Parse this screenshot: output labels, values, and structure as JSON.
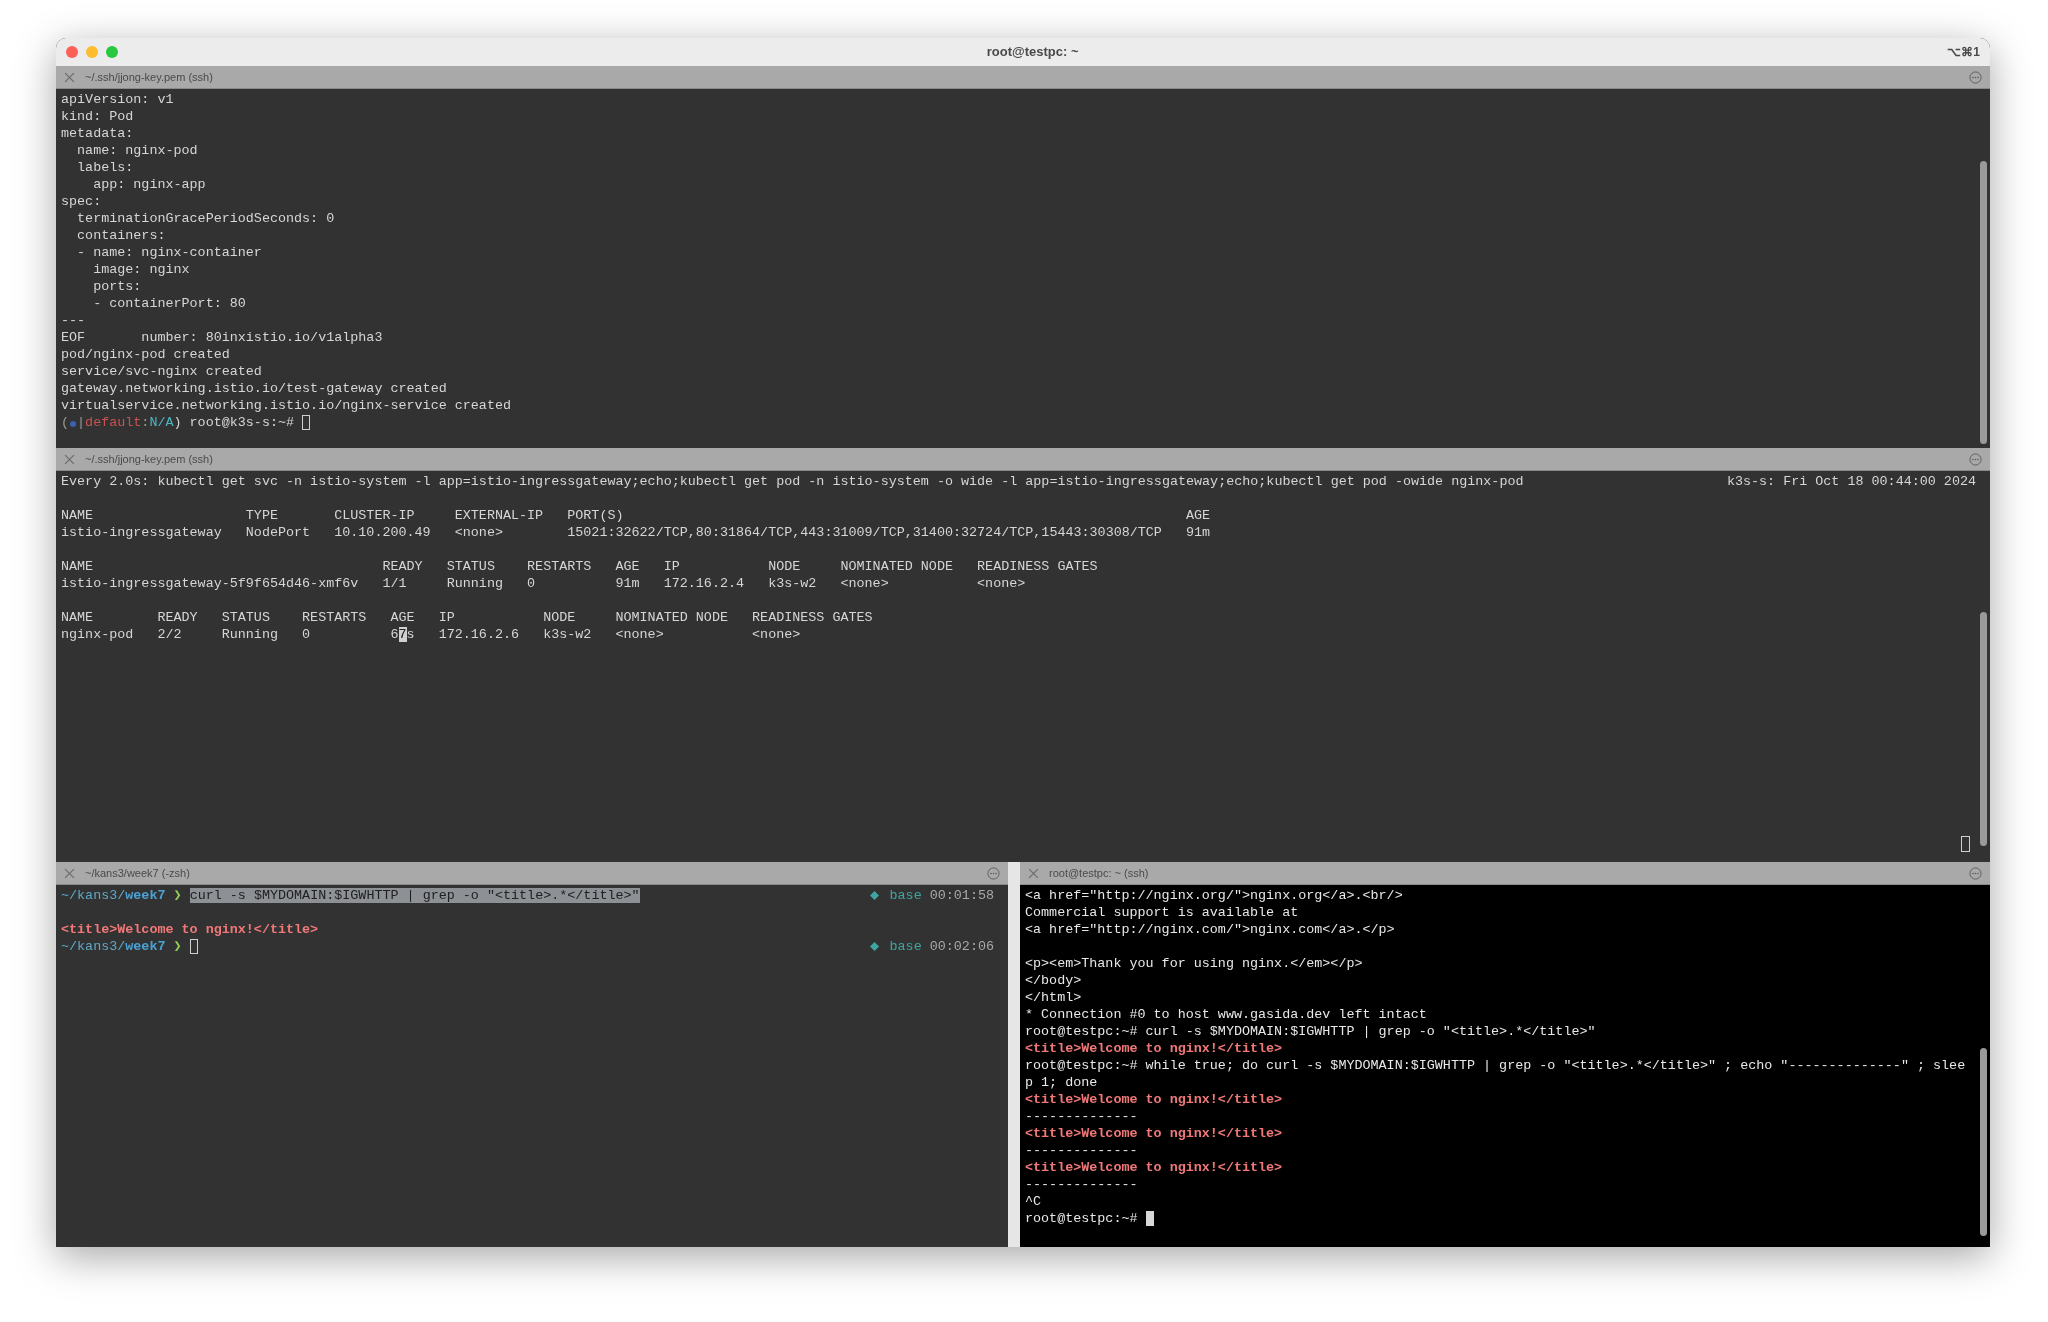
{
  "window": {
    "title": "root@testpc: ~",
    "shortcut": "⌥⌘1"
  },
  "panes": [
    {
      "title": "~/.ssh/jjong-key.pem (ssh)",
      "kind": "dark",
      "lines": [
        {
          "segments": [
            {
              "kind": "plain",
              "text": "apiVersion: v1"
            }
          ]
        },
        {
          "segments": [
            {
              "kind": "plain",
              "text": "kind: Pod"
            }
          ]
        },
        {
          "segments": [
            {
              "kind": "plain",
              "text": "metadata:"
            }
          ]
        },
        {
          "segments": [
            {
              "kind": "plain",
              "text": "  name: nginx-pod"
            }
          ]
        },
        {
          "segments": [
            {
              "kind": "plain",
              "text": "  labels:"
            }
          ]
        },
        {
          "segments": [
            {
              "kind": "plain",
              "text": "    app: nginx-app"
            }
          ]
        },
        {
          "segments": [
            {
              "kind": "plain",
              "text": "spec:"
            }
          ]
        },
        {
          "segments": [
            {
              "kind": "plain",
              "text": "  terminationGracePeriodSeconds: 0"
            }
          ]
        },
        {
          "segments": [
            {
              "kind": "plain",
              "text": "  containers:"
            }
          ]
        },
        {
          "segments": [
            {
              "kind": "plain",
              "text": "  - name: nginx-container"
            }
          ]
        },
        {
          "segments": [
            {
              "kind": "plain",
              "text": "    image: nginx"
            }
          ]
        },
        {
          "segments": [
            {
              "kind": "plain",
              "text": "    ports:"
            }
          ]
        },
        {
          "segments": [
            {
              "kind": "plain",
              "text": "    - containerPort: 80"
            }
          ]
        },
        {
          "segments": [
            {
              "kind": "plain",
              "text": "---"
            }
          ]
        },
        {
          "segments": [
            {
              "kind": "plain",
              "text": "EOF       number: 80inxistio.io/v1alpha3"
            }
          ]
        },
        {
          "segments": [
            {
              "kind": "plain",
              "text": "pod/nginx-pod created"
            }
          ]
        },
        {
          "segments": [
            {
              "kind": "plain",
              "text": "service/svc-nginx created"
            }
          ]
        },
        {
          "segments": [
            {
              "kind": "plain",
              "text": "gateway.networking.istio.io/test-gateway created"
            }
          ]
        },
        {
          "segments": [
            {
              "kind": "plain",
              "text": "virtualservice.networking.istio.io/nginx-service created"
            }
          ]
        },
        {
          "segments": [
            {
              "kind": "dim",
              "text": "("
            },
            {
              "kind": "k8s_icon"
            },
            {
              "kind": "dim",
              "text": "|"
            },
            {
              "kind": "context_red",
              "text": "default"
            },
            {
              "kind": "dim",
              "text": ":"
            },
            {
              "kind": "context_cyan",
              "text": "N/A"
            },
            {
              "kind": "plain",
              "text": ") root@k3s-s:~# "
            },
            {
              "kind": "cursor_hollow"
            }
          ]
        }
      ]
    },
    {
      "title": "~/.ssh/jjong-key.pem (ssh)",
      "kind": "dark",
      "idle_cursor": true,
      "lines": [
        {
          "segments": [
            {
              "kind": "plain",
              "text": "Every 2.0s: kubectl get svc -n istio-system -l app=istio-ingressgateway;echo;kubectl get pod -n istio-system -o wide -l app=istio-ingressgateway;echo;kubectl get pod -owide nginx-pod"
            }
          ],
          "right": [
            {
              "kind": "plain",
              "text": "k3s-s: Fri Oct 18 00:44:00 2024"
            }
          ]
        },
        {
          "space_before": true,
          "segments": [
            {
              "kind": "plain",
              "text": "NAME                   TYPE       CLUSTER-IP     EXTERNAL-IP   PORT(S)                                                                      AGE"
            }
          ]
        },
        {
          "segments": [
            {
              "kind": "plain",
              "text": "istio-ingressgateway   NodePort   10.10.200.49   <none>        15021:32622/TCP,80:31864/TCP,443:31009/TCP,31400:32724/TCP,15443:30308/TCP   91m"
            }
          ]
        },
        {
          "space_before": true,
          "segments": [
            {
              "kind": "plain",
              "text": "NAME                                    READY   STATUS    RESTARTS   AGE   IP           NODE     NOMINATED NODE   READINESS GATES"
            }
          ]
        },
        {
          "segments": [
            {
              "kind": "plain",
              "text": "istio-ingressgateway-5f9f654d46-xmf6v   1/1     Running   0          91m   172.16.2.4   k3s-w2   <none>           <none>"
            }
          ]
        },
        {
          "space_before": true,
          "segments": [
            {
              "kind": "plain",
              "text": "NAME        READY   STATUS    RESTARTS   AGE   IP           NODE     NOMINATED NODE   READINESS GATES"
            }
          ]
        },
        {
          "segments": [
            {
              "kind": "plain",
              "text": "nginx-pod   2/2     Running   0          6"
            },
            {
              "kind": "cursor_cell",
              "text": "7"
            },
            {
              "kind": "plain",
              "text": "s   172.16.2.6   k3s-w2   <none>           <none>"
            }
          ]
        }
      ]
    }
  ],
  "bottom_split": [
    {
      "title": "~/kans3/week7 (-zsh)",
      "kind": "dark",
      "lines": [
        {
          "segments": [
            {
              "kind": "path",
              "text": "~/kans3/"
            },
            {
              "kind": "path_bold",
              "text": "week7"
            },
            {
              "kind": "prompt_arrow",
              "text": " ❯ "
            },
            {
              "kind": "selection",
              "text": "curl -s $MYDOMAIN:$IGWHTTP | grep -o \"<title>.*</title>\""
            }
          ],
          "right": [
            {
              "kind": "env_icon"
            },
            {
              "kind": "env",
              "text": " base "
            },
            {
              "kind": "time",
              "text": "00:01:58"
            }
          ]
        },
        {
          "space_before": true,
          "segments": [
            {
              "kind": "title_red",
              "text": "<title>Welcome to nginx!</title>"
            }
          ]
        },
        {
          "segments": [
            {
              "kind": "path",
              "text": "~/kans3/"
            },
            {
              "kind": "path_bold",
              "text": "week7"
            },
            {
              "kind": "prompt_arrow",
              "text": " ❯ "
            },
            {
              "kind": "cursor_hollow"
            }
          ],
          "right": [
            {
              "kind": "env_icon"
            },
            {
              "kind": "env",
              "text": " base "
            },
            {
              "kind": "time",
              "text": "00:02:06"
            }
          ]
        }
      ]
    },
    {
      "title": "root@testpc: ~ (ssh)",
      "kind": "black",
      "lines": [
        {
          "segments": [
            {
              "kind": "plain",
              "text": "<a href=\"http://nginx.org/\">nginx.org</a>.<br/>"
            }
          ]
        },
        {
          "segments": [
            {
              "kind": "plain",
              "text": "Commercial support is available at"
            }
          ]
        },
        {
          "segments": [
            {
              "kind": "plain",
              "text": "<a href=\"http://nginx.com/\">nginx.com</a>.</p>"
            }
          ]
        },
        {
          "space_before": true,
          "segments": [
            {
              "kind": "plain",
              "text": "<p><em>Thank you for using nginx.</em></p>"
            }
          ]
        },
        {
          "segments": [
            {
              "kind": "plain",
              "text": "</body>"
            }
          ]
        },
        {
          "segments": [
            {
              "kind": "plain",
              "text": "</html>"
            }
          ]
        },
        {
          "segments": [
            {
              "kind": "plain",
              "text": "* Connection #0 to host www.gasida.dev left intact"
            }
          ]
        },
        {
          "segments": [
            {
              "kind": "plain",
              "text": "root@testpc:~# curl -s $MYDOMAIN:$IGWHTTP | grep -o \"<title>.*</title>\""
            }
          ]
        },
        {
          "segments": [
            {
              "kind": "title_red",
              "text": "<title>Welcome to nginx!</title>"
            }
          ]
        },
        {
          "segments": [
            {
              "kind": "plain",
              "text": "root@testpc:~# while true; do curl -s $MYDOMAIN:$IGWHTTP | grep -o \"<title>.*</title>\" ; echo \"--------------\" ; slee"
            }
          ]
        },
        {
          "segments": [
            {
              "kind": "plain",
              "text": "p 1; done"
            }
          ]
        },
        {
          "segments": [
            {
              "kind": "title_red",
              "text": "<title>Welcome to nginx!</title>"
            }
          ]
        },
        {
          "segments": [
            {
              "kind": "plain",
              "text": "--------------"
            }
          ]
        },
        {
          "segments": [
            {
              "kind": "title_red",
              "text": "<title>Welcome to nginx!</title>"
            }
          ]
        },
        {
          "segments": [
            {
              "kind": "plain",
              "text": "--------------"
            }
          ]
        },
        {
          "segments": [
            {
              "kind": "title_red",
              "text": "<title>Welcome to nginx!</title>"
            }
          ]
        },
        {
          "segments": [
            {
              "kind": "plain",
              "text": "--------------"
            }
          ]
        },
        {
          "segments": [
            {
              "kind": "plain",
              "text": "^C"
            }
          ]
        },
        {
          "segments": [
            {
              "kind": "plain",
              "text": "root@testpc:~# "
            },
            {
              "kind": "cursor_block"
            }
          ]
        }
      ]
    }
  ]
}
